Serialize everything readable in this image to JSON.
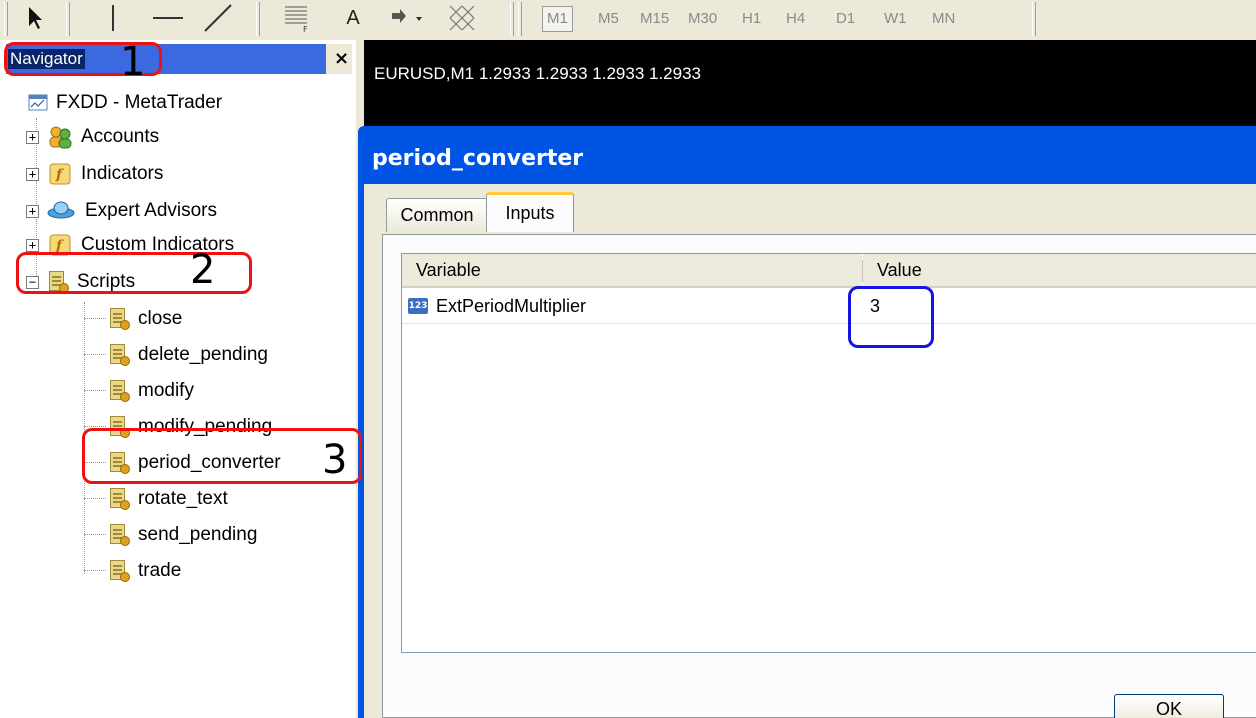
{
  "toolbar": {
    "font_tool_label": "A",
    "timeframes": [
      "M1",
      "M5",
      "M15",
      "M30",
      "H1",
      "H4",
      "D1",
      "W1",
      "MN"
    ]
  },
  "navigator": {
    "title": "Navigator",
    "close_glyph": "×",
    "root": "FXDD - MetaTrader",
    "groups": [
      {
        "label": "Accounts",
        "icon": "accounts-icon",
        "expander": "+"
      },
      {
        "label": "Indicators",
        "icon": "indicators-icon",
        "expander": "+"
      },
      {
        "label": "Expert Advisors",
        "icon": "expert-advisors-icon",
        "expander": "+"
      },
      {
        "label": "Custom Indicators",
        "icon": "custom-indicators-icon",
        "expander": "+"
      },
      {
        "label": "Scripts",
        "icon": "scripts-icon",
        "expander": "−"
      }
    ],
    "scripts": [
      "close",
      "delete_pending",
      "modify",
      "modify_pending",
      "period_converter",
      "rotate_text",
      "send_pending",
      "trade"
    ]
  },
  "annotations": {
    "n1": "1",
    "n2": "2",
    "n3": "3",
    "color_red": "#ee1111",
    "color_blue": "#1414e6"
  },
  "chart": {
    "header": "EURUSD,M1  1.2933 1.2933 1.2933 1.2933"
  },
  "dialog": {
    "title": "period_converter",
    "tabs": [
      "Common",
      "Inputs"
    ],
    "active_tab": "Inputs",
    "columns": [
      "Variable",
      "Value"
    ],
    "rows": [
      {
        "variable": "ExtPeriodMultiplier",
        "value": "3",
        "type_badge": "123"
      }
    ],
    "ok_label": "OK"
  }
}
